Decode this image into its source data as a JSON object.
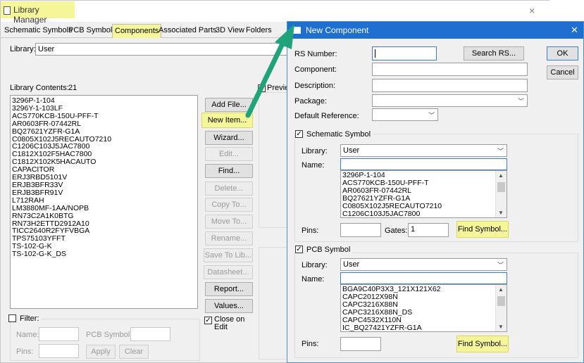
{
  "library_manager": {
    "title": "Library Manager",
    "close": "×",
    "tabs": [
      "Schematic Symbols",
      "PCB Symbols",
      "Components",
      "Associated Parts",
      "3D View",
      "Folders"
    ],
    "library_label": "Library:",
    "library_value": "User",
    "contents_label": "Library Contents:",
    "contents_count": "21",
    "preview_label": "Previe",
    "items": [
      "3296P-1-104",
      "3296Y-1-103LF",
      "ACS770KCB-150U-PFF-T",
      "AR0603FR-07442RL",
      "BQ27621YZFR-G1A",
      "C0805X102J5RECAUTO7210",
      "C1206C103J5JAC7800",
      "C1812X102F5HAC7800",
      "C1812X102K5HACAUTO",
      "CAPACITOR",
      "ERJ3RBD5101V",
      "ERJB3BFR33V",
      "ERJB3BFR91V",
      "L712RAH",
      "LM3880MF-1AA/NOPB",
      "RN73C2A1K0BTG",
      "RN73H2ETTD2912A10",
      "TICC2640R2FYFVBGA",
      "TPS75103YFFT",
      "TS-102-G-K",
      "TS-102-G-K_DS"
    ],
    "buttons": {
      "add_file": "Add File...",
      "new_item": "New Item...",
      "wizard": "Wizard...",
      "edit": "Edit...",
      "find": "Find...",
      "delete": "Delete...",
      "copy_to": "Copy To...",
      "move_to": "Move To...",
      "rename": "Rename...",
      "save_to_lib": "Save To Lib...",
      "datasheet": "Datasheet...",
      "report": "Report...",
      "values": "Values..."
    },
    "close_on_edit": "Close on Edit",
    "filter": {
      "label": "Filter:",
      "name_label": "Name:",
      "pcb_symbol_label": "PCB Symbol:",
      "pins_label": "Pins:",
      "apply": "Apply",
      "clear": "Clear"
    }
  },
  "new_component": {
    "title": "New Component",
    "close": "✕",
    "rs_number_label": "RS Number:",
    "component_label": "Component:",
    "description_label": "Description:",
    "package_label": "Package:",
    "default_reference_label": "Default Reference:",
    "search_rs": "Search RS...",
    "ok": "OK",
    "cancel": "Cancel",
    "schematic": {
      "group_label": "Schematic Symbol",
      "library_label": "Library:",
      "library_value": "User",
      "name_label": "Name:",
      "items": [
        "3296P-1-104",
        "ACS770KCB-150U-PFF-T",
        "AR0603FR-07442RL",
        "BQ27621YZFR-G1A",
        "C0805X102J5RECAUTO7210",
        "C1206C103J5JAC7800"
      ],
      "pins_label": "Pins:",
      "gates_label": "Gates:",
      "gates_value": "1",
      "find_symbol": "Find Symbol..."
    },
    "pcb": {
      "group_label": "PCB Symbol",
      "library_label": "Library:",
      "library_value": "User",
      "name_label": "Name:",
      "items": [
        "BGA9C40P3X3_121X121X62",
        "CAPC2012X98N",
        "CAPC3216X88N",
        "CAPC3216X88N_DS",
        "CAPC4532X110N",
        "IC_BQ27421YZFR-G1A"
      ],
      "pins_label": "Pins:",
      "find_symbol": "Find Symbol..."
    }
  },
  "colors": {
    "highlight": "#f5f59a",
    "dialog_title": "#1e6fd0",
    "arrow": "#1fa37a"
  }
}
